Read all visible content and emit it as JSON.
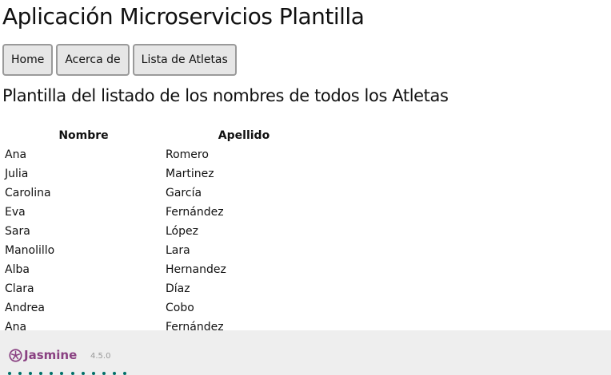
{
  "app": {
    "title": "Aplicación Microservicios Plantilla"
  },
  "nav": {
    "items": [
      {
        "label": "Home"
      },
      {
        "label": "Acerca de"
      },
      {
        "label": "Lista de Atletas"
      }
    ]
  },
  "list": {
    "title": "Plantilla del listado de los nombres de todos los Atletas",
    "columns": [
      "Nombre",
      "Apellido"
    ],
    "rows": [
      {
        "nombre": "Ana",
        "apellido": "Romero"
      },
      {
        "nombre": "Julia",
        "apellido": "Martinez"
      },
      {
        "nombre": "Carolina",
        "apellido": "García"
      },
      {
        "nombre": "Eva",
        "apellido": "Fernández"
      },
      {
        "nombre": "Sara",
        "apellido": "López"
      },
      {
        "nombre": "Manolillo",
        "apellido": "Lara"
      },
      {
        "nombre": "Alba",
        "apellido": "Hernandez"
      },
      {
        "nombre": "Clara",
        "apellido": "Díaz"
      },
      {
        "nombre": "Andrea",
        "apellido": "Cobo"
      },
      {
        "nombre": "Ana",
        "apellido": "Fernández"
      }
    ]
  },
  "jasmine": {
    "name": "Jasmine",
    "version": "4.5.0",
    "brand_color": "#8a4182",
    "passed_color": "#007069",
    "spec_count": 12
  }
}
